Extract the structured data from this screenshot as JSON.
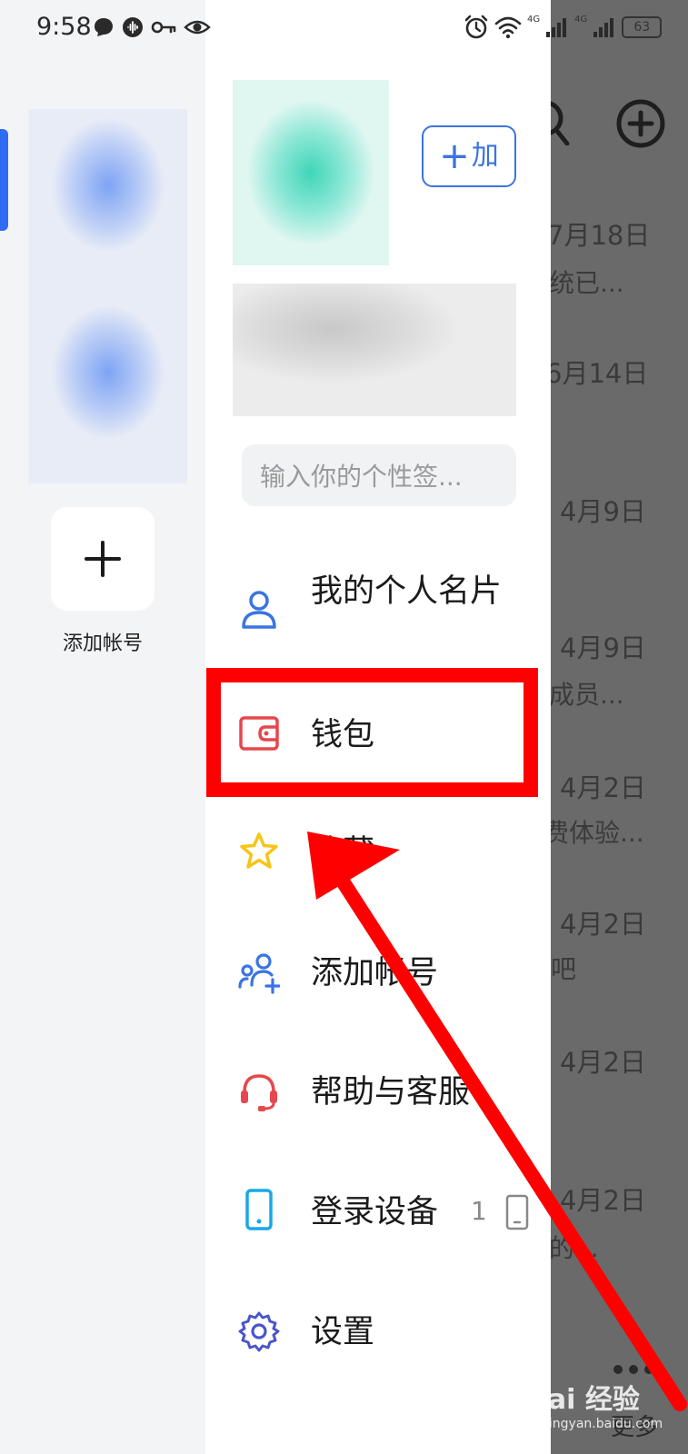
{
  "status_bar": {
    "time": "9:58",
    "battery": "63",
    "net_left": "4G",
    "net_right": "4G"
  },
  "accounts_panel": {
    "add_account_label": "添加帐号"
  },
  "drawer": {
    "add_friend_button": "加",
    "signature_placeholder": "输入你的个性签...",
    "menu": [
      {
        "label": "我的个人名片",
        "icon": "person-icon",
        "color": "#3a74e0"
      },
      {
        "label": "钱包",
        "icon": "wallet-icon",
        "color": "#e5484d"
      },
      {
        "label": "收藏",
        "icon": "star-icon",
        "color": "#f5c518"
      },
      {
        "label": "添加帐号",
        "icon": "add-people-icon",
        "color": "#3a74e0"
      },
      {
        "label": "帮助与客服",
        "icon": "headset-icon",
        "color": "#e5484d"
      },
      {
        "label": "登录设备",
        "icon": "phone-icon",
        "color": "#1aa8e8",
        "count": "1"
      },
      {
        "label": "设置",
        "icon": "gear-icon",
        "color": "#4a56c9"
      }
    ]
  },
  "background_list": {
    "rows": [
      {
        "date": "7月18日",
        "text": "统已..."
      },
      {
        "date": "6月14日",
        "text": ""
      },
      {
        "date": "4月9日",
        "text": ""
      },
      {
        "date": "4月9日",
        "text": "成员..."
      },
      {
        "date": "4月2日",
        "text": "费体验..."
      },
      {
        "date": "4月2日",
        "text": "吧"
      },
      {
        "date": "4月2日",
        "text": ""
      },
      {
        "date": "4月2日",
        "text": "的..."
      }
    ],
    "more_label": "更多"
  },
  "watermark": {
    "main": "Bai 经验",
    "sub": "jingyan.baidu.com"
  },
  "colors": {
    "accent": "#3a74e0",
    "highlight": "#ff0000",
    "dim": "#6a6a6a"
  }
}
